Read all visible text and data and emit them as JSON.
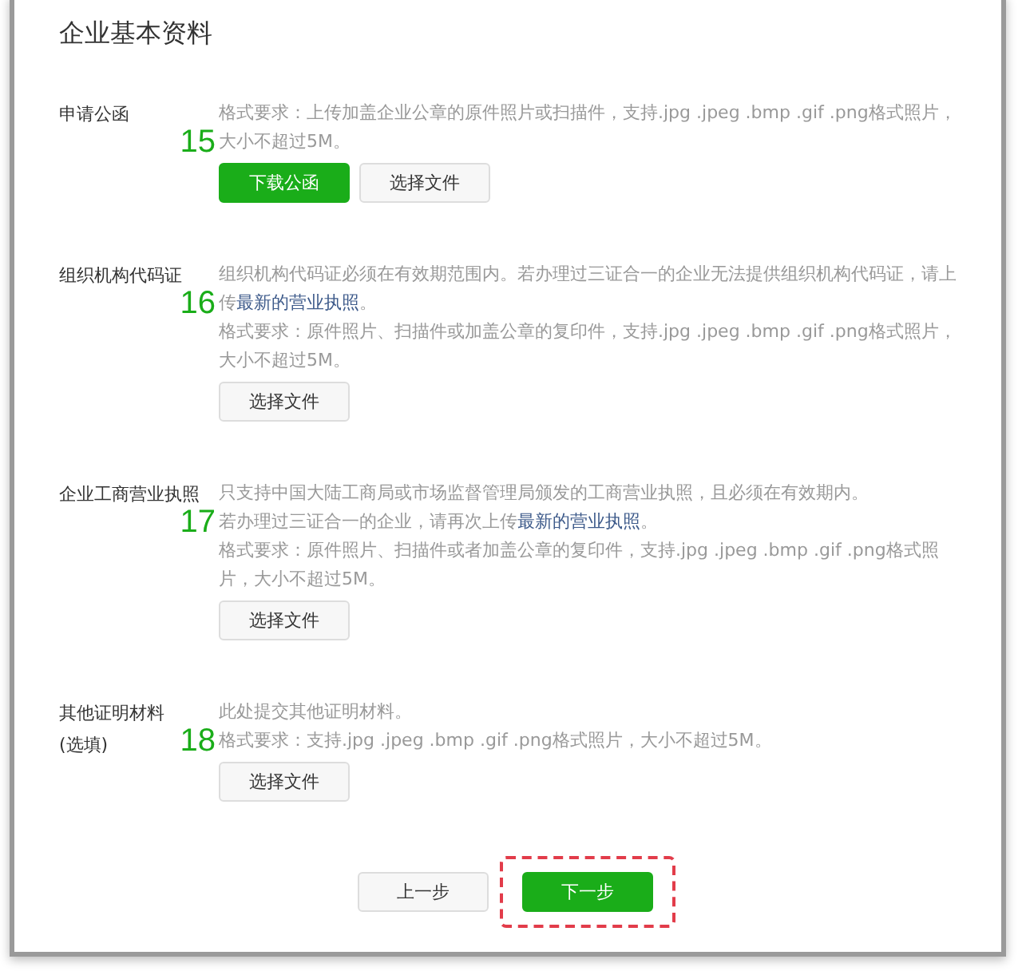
{
  "title": "企业基本资料",
  "sections": [
    {
      "label": [
        "申请公函"
      ],
      "annotation": "15",
      "paragraphs": [
        [
          {
            "kind": "text",
            "text": "格式要求：上传加盖企业公章的原件照片或扫描件，支持.jpg .jpeg .bmp .gif .png格式照片，大小不超过5M。"
          }
        ]
      ],
      "buttons": [
        {
          "label": "下载公函",
          "primary": true
        },
        {
          "label": "选择文件",
          "primary": false
        }
      ]
    },
    {
      "label": [
        "组织机构代码证"
      ],
      "annotation": "16",
      "paragraphs": [
        [
          {
            "kind": "text",
            "text": "组织机构代码证必须在有效期范围内。若办理过三证合一的企业无法提供组织机构代码证，请上传"
          },
          {
            "kind": "link",
            "text": "最新的营业执照"
          },
          {
            "kind": "text",
            "text": "。"
          }
        ],
        [
          {
            "kind": "text",
            "text": "格式要求：原件照片、扫描件或加盖公章的复印件，支持.jpg .jpeg .bmp .gif .png格式照片，大小不超过5M。"
          }
        ]
      ],
      "buttons": [
        {
          "label": "选择文件",
          "primary": false
        }
      ]
    },
    {
      "label": [
        "企业工商营业执照"
      ],
      "annotation": "17",
      "paragraphs": [
        [
          {
            "kind": "text",
            "text": "只支持中国大陆工商局或市场监督管理局颁发的工商营业执照，且必须在有效期内。"
          }
        ],
        [
          {
            "kind": "text",
            "text": "若办理过三证合一的企业，请再次上传"
          },
          {
            "kind": "link",
            "text": "最新的营业执照"
          },
          {
            "kind": "text",
            "text": "。"
          }
        ],
        [
          {
            "kind": "text",
            "text": "格式要求：原件照片、扫描件或者加盖公章的复印件，支持.jpg .jpeg .bmp .gif .png格式照片，大小不超过5M。"
          }
        ]
      ],
      "buttons": [
        {
          "label": "选择文件",
          "primary": false
        }
      ]
    },
    {
      "label": [
        "其他证明材料",
        "(选填)"
      ],
      "annotation": "18",
      "paragraphs": [
        [
          {
            "kind": "text",
            "text": "此处提交其他证明材料。"
          }
        ],
        [
          {
            "kind": "text",
            "text": "格式要求：支持.jpg .jpeg .bmp .gif .png格式照片，大小不超过5M。"
          }
        ]
      ],
      "buttons": [
        {
          "label": "选择文件",
          "primary": false
        }
      ]
    }
  ],
  "footer": [
    {
      "label": "上一步",
      "primary": false,
      "highlighted": false
    },
    {
      "label": "下一步",
      "primary": true,
      "highlighted": true
    }
  ]
}
